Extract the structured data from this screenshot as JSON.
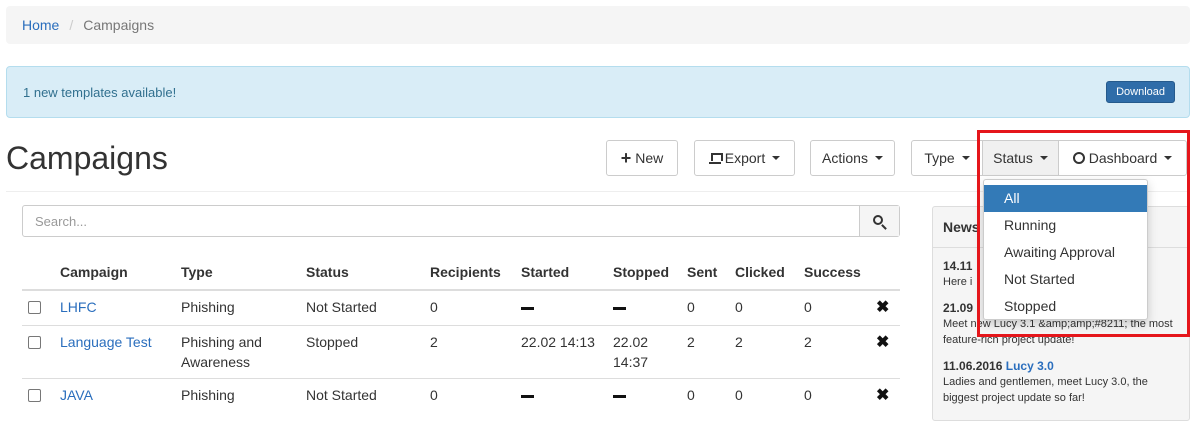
{
  "breadcrumb": {
    "home": "Home",
    "separator": "/",
    "current": "Campaigns"
  },
  "alert": {
    "message": "1 new templates available!",
    "button": "Download"
  },
  "page": {
    "title": "Campaigns"
  },
  "toolbar": {
    "new": "New",
    "export": "Export",
    "actions": "Actions",
    "type": "Type",
    "status": "Status",
    "dashboard": "Dashboard"
  },
  "status_menu": {
    "items": [
      "All",
      "Running",
      "Awaiting Approval",
      "Not Started",
      "Stopped"
    ],
    "selected": "All"
  },
  "search": {
    "placeholder": "Search..."
  },
  "table": {
    "columns": [
      "Campaign",
      "Type",
      "Status",
      "Recipients",
      "Started",
      "Stopped",
      "Sent",
      "Clicked",
      "Success"
    ],
    "rows": [
      {
        "name": "LHFC",
        "type": "Phishing",
        "status": "Not Started",
        "recipients": "0",
        "started": "",
        "stopped": "",
        "sent": "0",
        "clicked": "0",
        "success": "0"
      },
      {
        "name": "Language Test",
        "type": "Phishing and Awareness",
        "status": "Stopped",
        "recipients": "2",
        "started": "22.02 14:13",
        "stopped": "22.02 14:37",
        "sent": "2",
        "clicked": "2",
        "success": "2"
      },
      {
        "name": "JAVA",
        "type": "Phishing",
        "status": "Not Started",
        "recipients": "0",
        "started": "",
        "stopped": "",
        "sent": "0",
        "clicked": "0",
        "success": "0"
      }
    ]
  },
  "news": {
    "title": "News",
    "items": [
      {
        "date": "14.11",
        "link": "",
        "text": "Here i"
      },
      {
        "date": "21.09",
        "link": "",
        "text": "Meet new Lucy 3.1 &amp;amp;#8211; the most feature-rich project update!"
      },
      {
        "date": "11.06.2016",
        "link": "Lucy 3.0",
        "text": "Ladies and gentlemen, meet Lucy 3.0, the biggest project update so far!"
      }
    ]
  }
}
